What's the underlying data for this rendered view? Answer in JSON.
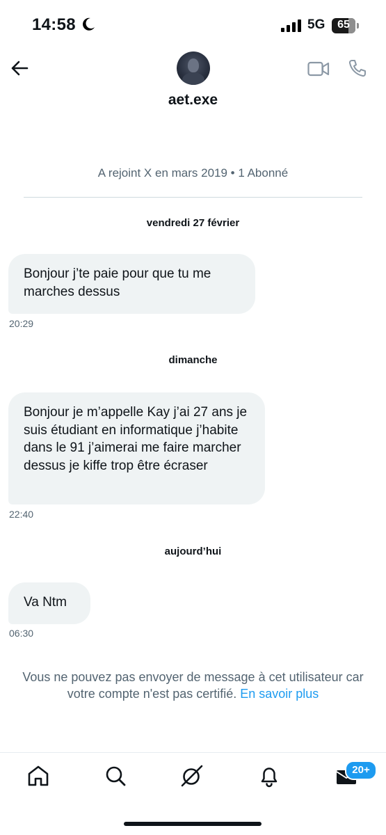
{
  "status_bar": {
    "time": "14:58",
    "network": "5G",
    "battery": "65"
  },
  "header": {
    "username": "aet.exe",
    "joined": "A rejoint X en mars 2019 • 1 Abonné"
  },
  "conversation": [
    {
      "date": "vendredi 27 février",
      "message": "Bonjour j’te paie pour que tu me marches dessus",
      "time": "20:29"
    },
    {
      "date": "dimanche",
      "message": "Bonjour je m’appelle Kay j’ai 27 ans je suis étudiant en informatique j’habite dans le 91 j’aimerai me faire marcher dessus je kiffe trop être écraser",
      "time": "22:40"
    },
    {
      "date": "aujourd’hui",
      "message": "Va Ntm",
      "time": "06:30"
    }
  ],
  "notice": {
    "text": "Vous ne pouvez pas envoyer de message à cet utilisateur car votre compte n'est pas certifié.",
    "link": "En savoir plus"
  },
  "tabbar": {
    "messages_badge": "20+"
  },
  "icons": {
    "back": "arrow-left-icon",
    "video": "video-camera-icon",
    "phone": "phone-icon",
    "home": "home-icon",
    "search": "search-icon",
    "grok": "grok-icon",
    "notifications": "bell-icon",
    "messages": "envelope-icon"
  },
  "colors": {
    "accent": "#1d9bf0",
    "bubble": "#eff3f4",
    "muted_text": "#536471"
  }
}
